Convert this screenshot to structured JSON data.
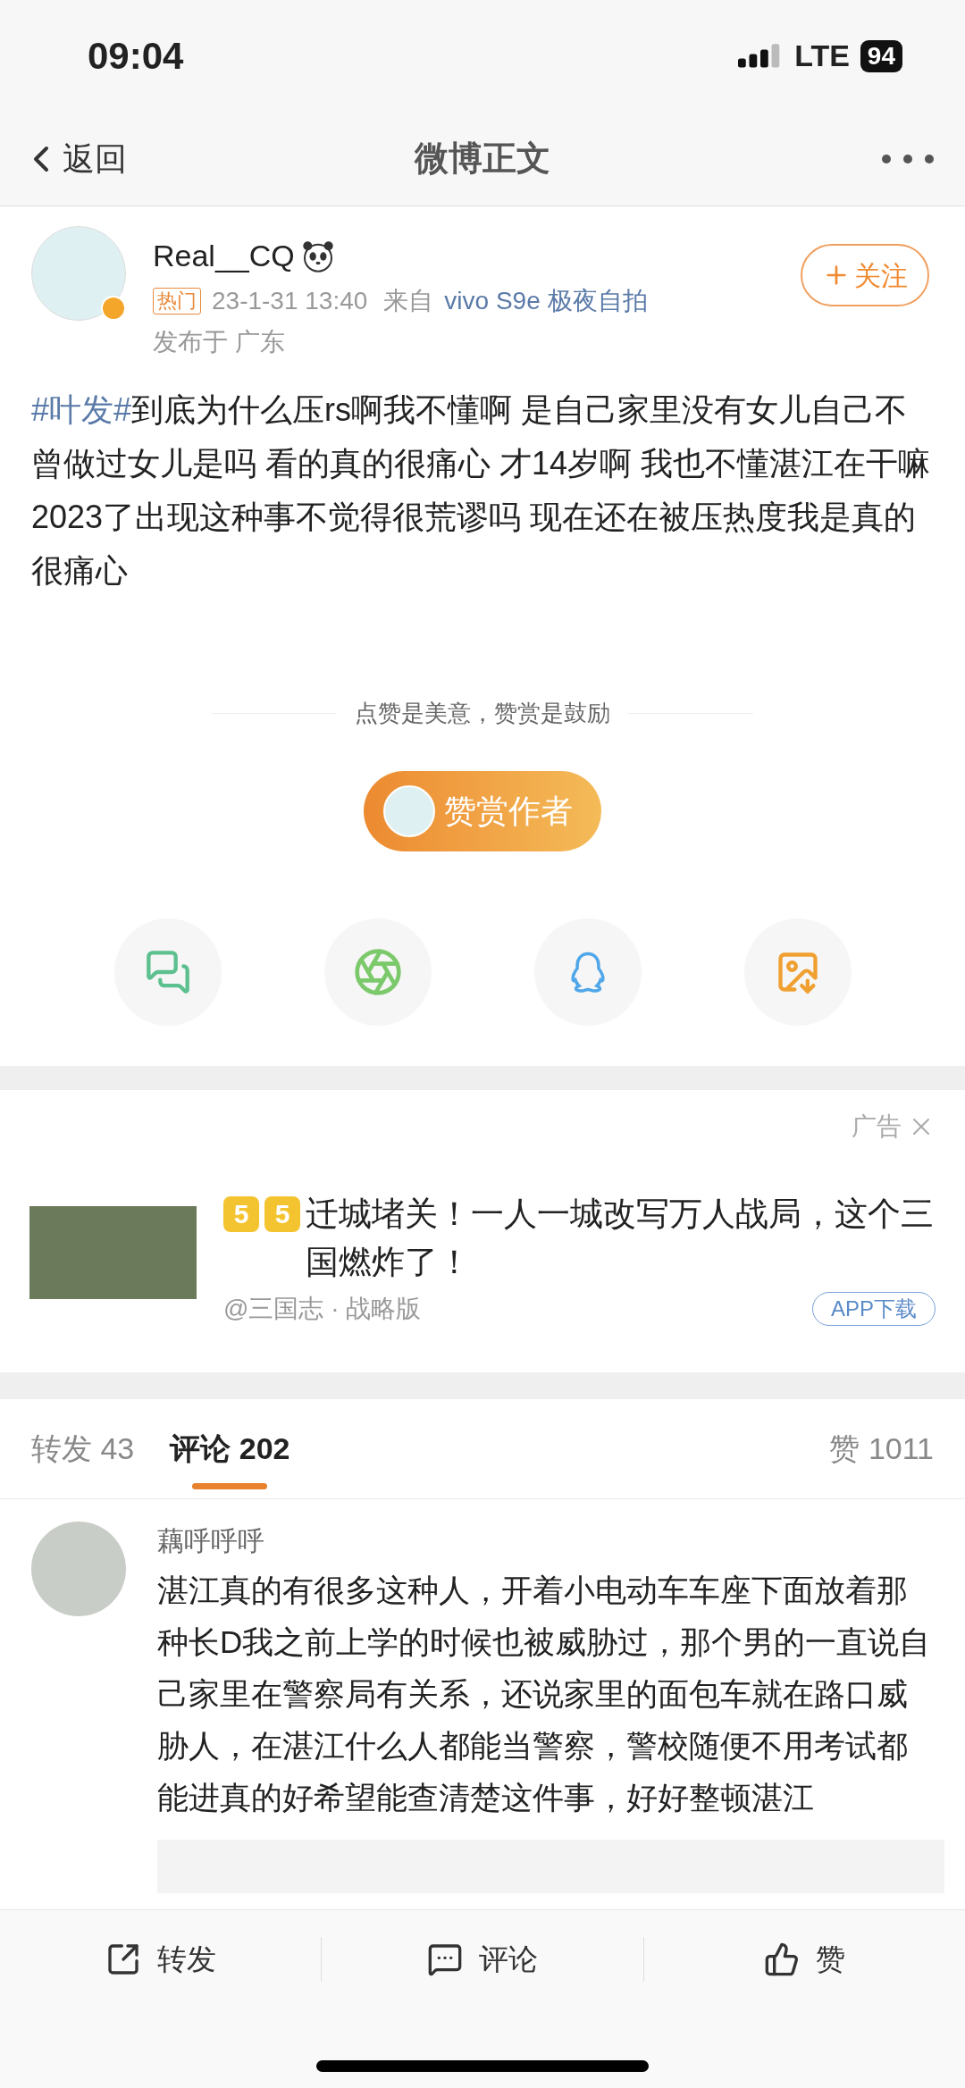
{
  "status_bar": {
    "time": "09:04",
    "network": "LTE",
    "battery": "94"
  },
  "nav": {
    "back": "返回",
    "title": "微博正文"
  },
  "post": {
    "author": "Real__CQ",
    "badge": "热门",
    "time": "23-1-31 13:40",
    "source_prefix": "来自",
    "source": "vivo S9e 极夜自拍",
    "location": "发布于 广东",
    "follow": "关注",
    "hashtag": "#叶发#",
    "text": "到底为什么压rs啊我不懂啊 是自己家里没有女儿自己不曾做过女儿是吗 看的真的很痛心 才14岁啊 我也不懂湛江在干嘛 2023了出现这种事不觉得很荒谬吗 现在还在被压热度我是真的很痛心"
  },
  "reward": {
    "tagline": "点赞是美意，赞赏是鼓励",
    "button": "赞赏作者"
  },
  "share": [
    {
      "kind": "wechat"
    },
    {
      "kind": "moments"
    },
    {
      "kind": "qq"
    },
    {
      "kind": "save_image"
    }
  ],
  "ad": {
    "label": "广告",
    "marks": [
      "5",
      "5"
    ],
    "title": "迁城堵关！一人一城改写万人战局，这个三国燃炸了！",
    "source": "@三国志 · 战略版",
    "button": "APP下载"
  },
  "tabs": [
    {
      "label": "转发",
      "count": "43",
      "selected": false
    },
    {
      "label": "评论",
      "count": "202",
      "selected": true
    }
  ],
  "likes": {
    "label": "赞",
    "count": "1011"
  },
  "comments": [
    {
      "author": "藕呼呼呼",
      "text": "湛江真的有很多这种人，开着小电动车车座下面放着那种长D我之前上学的时候也被威胁过，那个男的一直说自己家里在警察局有关系，还说家里的面包车就在路口威胁人，在湛江什么人都能当警察，警校随便不用考试都能进真的好希望能查清楚这件事，好好整顿湛江"
    }
  ],
  "bottom_actions": [
    {
      "kind": "repost",
      "label": "转发"
    },
    {
      "kind": "comment",
      "label": "评论"
    },
    {
      "kind": "like",
      "label": "赞"
    }
  ]
}
